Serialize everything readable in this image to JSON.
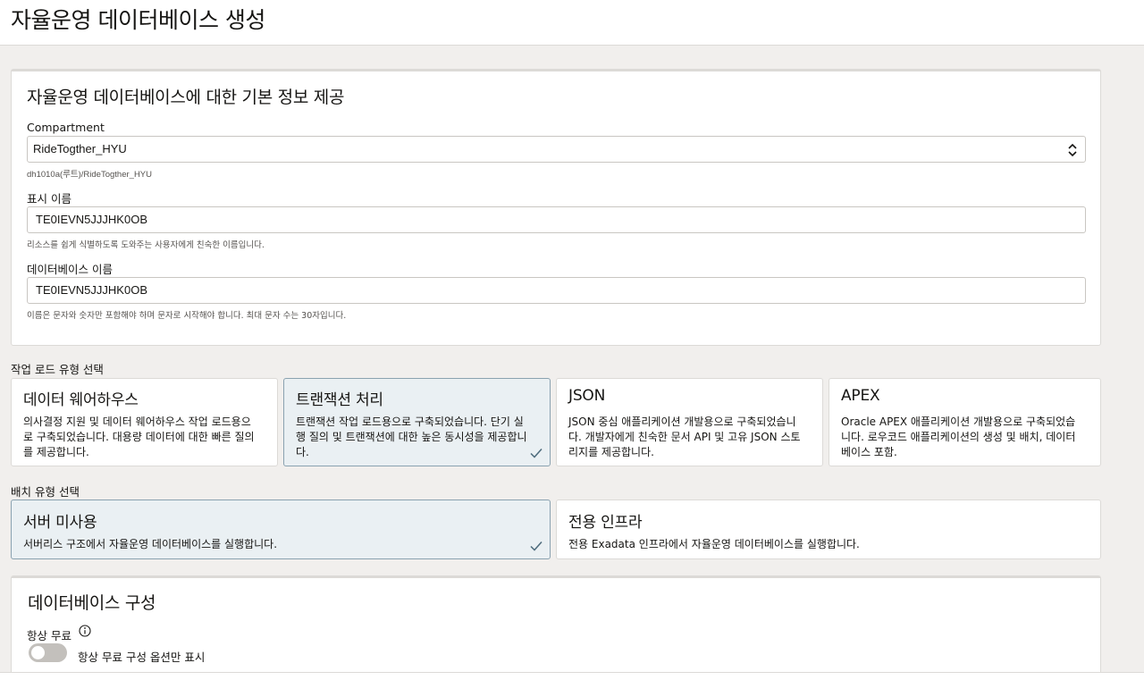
{
  "page": {
    "title": "자율운영 데이터베이스 생성"
  },
  "basic_info": {
    "title": "자율운영 데이터베이스에 대한 기본 정보 제공",
    "compartment": {
      "label": "Compartment",
      "value": "RideTogther_HYU",
      "path": "dh1010a(루트)/RideTogther_HYU"
    },
    "display_name": {
      "label": "표시 이름",
      "value": "TE0IEVN5JJJHK0OB",
      "helper": "리소스를 쉽게 식별하도록 도와주는 사용자에게 친숙한 이름입니다."
    },
    "db_name": {
      "label": "데이터베이스 이름",
      "value": "TE0IEVN5JJJHK0OB",
      "helper": "이름은 문자와 숫자만 포함해야 하며 문자로 시작해야 합니다. 최대 문자 수는 30자입니다."
    }
  },
  "workload": {
    "label": "작업 로드 유형 선택",
    "cards": [
      {
        "title": "데이터 웨어하우스",
        "desc": "의사결정 지원 및 데이터 웨어하우스 작업 로드용으로 구축되었습니다. 대용량 데이터에 대한 빠른 질의를 제공합니다.",
        "selected": false
      },
      {
        "title": "트랜잭션 처리",
        "desc": "트랜잭션 작업 로드용으로 구축되었습니다. 단기 실행 질의 및 트랜잭션에 대한 높은 동시성을 제공합니다.",
        "selected": true
      },
      {
        "title": "JSON",
        "desc": "JSON 중심 애플리케이션 개발용으로 구축되었습니다. 개발자에게 친숙한 문서 API 및 고유 JSON 스토리지를 제공합니다.",
        "selected": false
      },
      {
        "title": "APEX",
        "desc": "Oracle APEX 애플리케이션 개발용으로 구축되었습니다. 로우코드 애플리케이션의 생성 및 배치, 데이터베이스 포함.",
        "selected": false
      }
    ]
  },
  "deployment": {
    "label": "배치 유형 선택",
    "cards": [
      {
        "title": "서버 미사용",
        "desc": "서버리스 구조에서 자율운영 데이터베이스를 실행합니다.",
        "selected": true
      },
      {
        "title": "전용 인프라",
        "desc": "전용 Exadata 인프라에서 자율운영 데이터베이스를 실행합니다.",
        "selected": false
      }
    ]
  },
  "db_config": {
    "title": "데이터베이스 구성",
    "always_free": {
      "label": "항상 무료",
      "toggle_label": "항상 무료 구성 옵션만 표시",
      "enabled": false
    }
  },
  "colors": {
    "selected_card_bg": "#eaf0f3",
    "selected_card_border": "#8aa2b0",
    "check": "#4d6b7c"
  },
  "icons": [
    "chevron-updown-icon",
    "check-icon",
    "info-icon"
  ]
}
